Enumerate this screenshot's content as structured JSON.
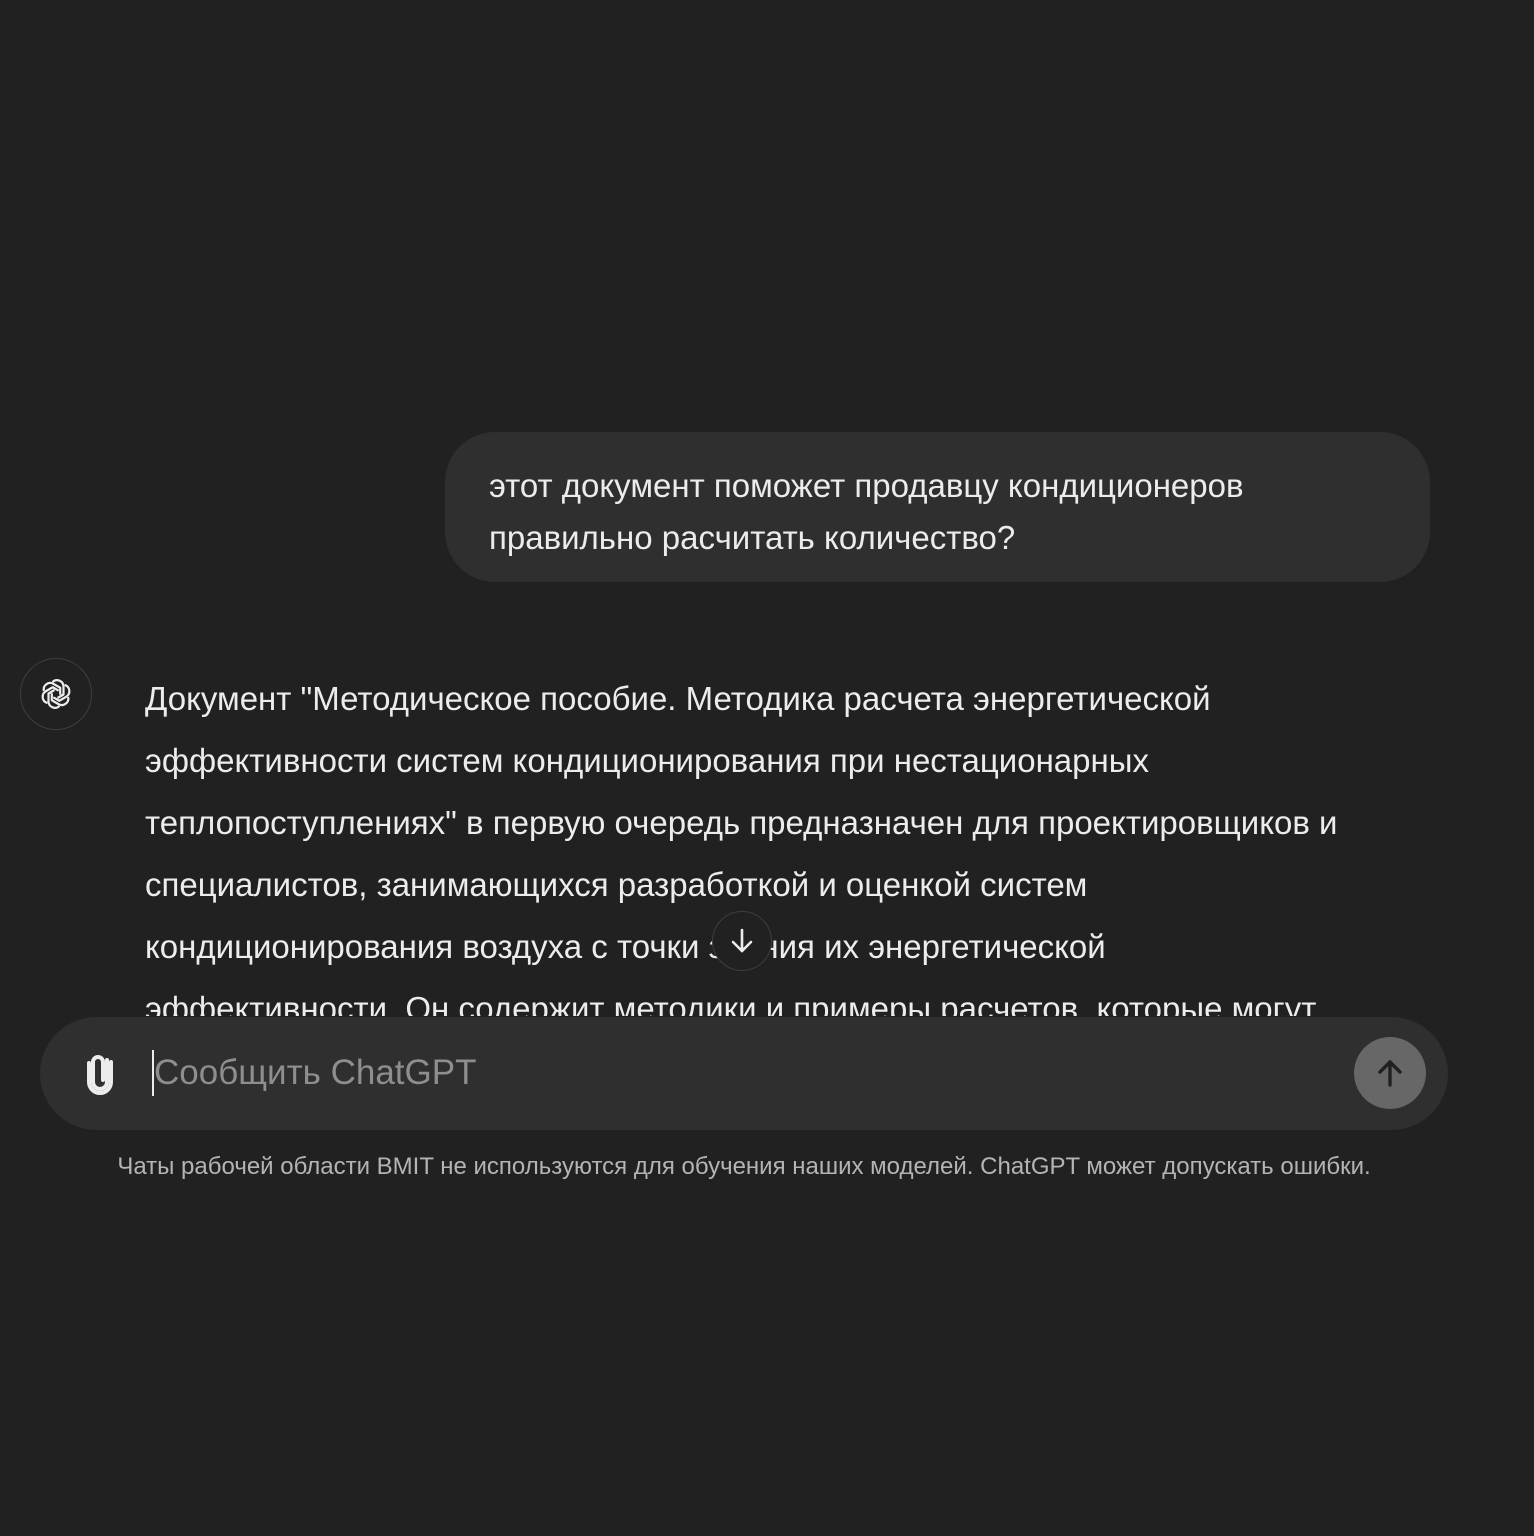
{
  "conversation": {
    "user_message": {
      "lines": [
        "этот документ поможет продавцу кондиционеров",
        "правильно расчитать количество?"
      ]
    },
    "assistant_message": {
      "avatar_icon": "openai-logo-icon",
      "lines": [
        "Документ \"Методическое пособие. Методика расчета энергетической",
        "эффективности систем кондиционирования при нестационарных",
        "теплопоступлениях\" в первую очередь предназначен для проектировщиков и",
        "специалистов, занимающихся разработкой и оценкой систем",
        "кондиционирования воздуха с точки зрения их энергетической",
        "эффективности. Он содержит методики и примеры расчетов, которые могут"
      ]
    },
    "scroll_down_icon": "arrow-down-icon"
  },
  "composer": {
    "placeholder": "Сообщить ChatGPT",
    "value": "",
    "attach_icon": "paperclip-icon",
    "send_icon": "arrow-up-icon"
  },
  "footer": {
    "disclaimer": "Чаты рабочей области BMIT не используются для обучения наших моделей. ChatGPT может допускать ошибки."
  },
  "colors": {
    "background": "#212121",
    "bubble": "#2f2f2f",
    "text": "#ececec",
    "placeholder": "#8e8e8e",
    "send_button": "#676767"
  }
}
